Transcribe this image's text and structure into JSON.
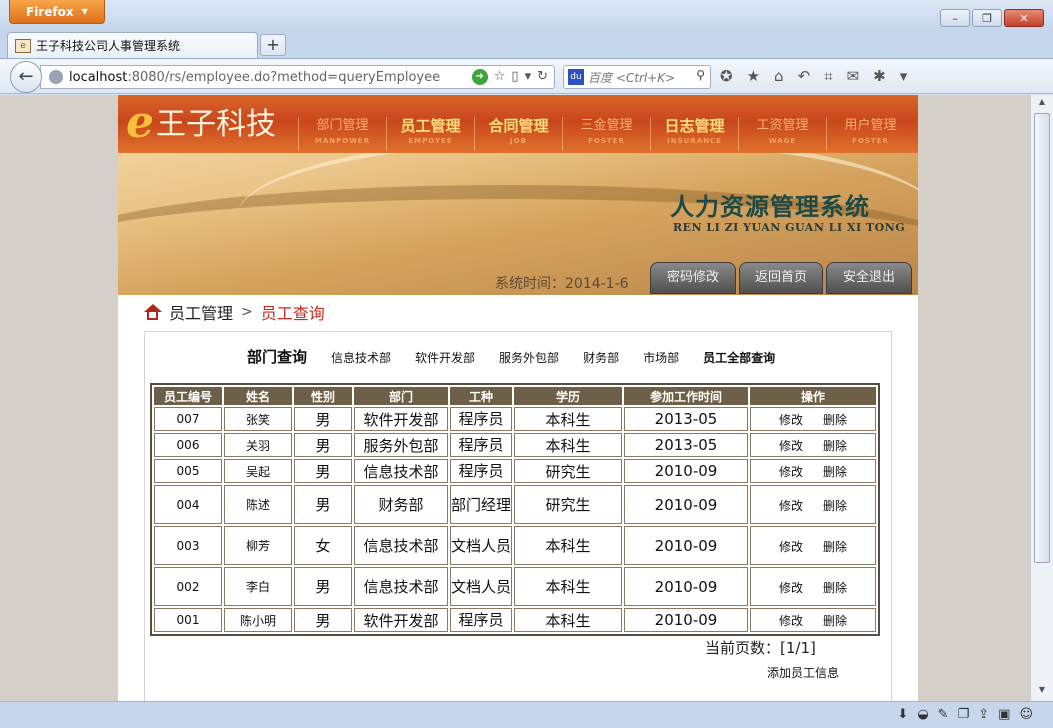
{
  "browser": {
    "app_button": "Firefox",
    "tab_title": "王子科技公司人事管理系统",
    "url_host": "localhost",
    "url_rest": ":8080/rs/employee.do?method=queryEmployee",
    "search_placeholder": "百度 <Ctrl+K>"
  },
  "header": {
    "logo_mark": "e",
    "logo_text": "王子科技",
    "nav": [
      {
        "zh": "部门管理",
        "en": "MANPOWER",
        "major": false
      },
      {
        "zh": "员工管理",
        "en": "EMPOYEE",
        "major": true
      },
      {
        "zh": "合同管理",
        "en": "JOB",
        "major": true
      },
      {
        "zh": "三金管理",
        "en": "FOSTER",
        "major": false
      },
      {
        "zh": "日志管理",
        "en": "INSURANCE",
        "major": true
      },
      {
        "zh": "工资管理",
        "en": "WAGE",
        "major": false
      },
      {
        "zh": "用户管理",
        "en": "FOSTER",
        "major": false
      }
    ],
    "system_title": "人力资源管理系统",
    "system_subtitle": "REN LI ZI YUAN GUAN LI XI TONG",
    "system_time": "系统时间：2014-1-6",
    "btn_password": "密码修改",
    "btn_home": "返回首页",
    "btn_logout": "安全退出"
  },
  "breadcrumb": {
    "parent": "员工管理",
    "separator": ">",
    "current": "员工查询"
  },
  "dept_filter": {
    "title": "部门查询",
    "links": [
      "信息技术部",
      "软件开发部",
      "服务外包部",
      "财务部",
      "市场部"
    ],
    "all_link": "员工全部查询"
  },
  "table": {
    "headers": [
      "员工编号",
      "姓名",
      "性别",
      "部门",
      "工种",
      "学历",
      "参加工作时间",
      "操作"
    ],
    "edit_label": "修改",
    "delete_label": "删除",
    "rows": [
      {
        "id": "007",
        "name": "张笑",
        "gender": "男",
        "dept": "软件开发部",
        "job": "程序员",
        "edu": "本科生",
        "start": "2013-05"
      },
      {
        "id": "006",
        "name": "关羽",
        "gender": "男",
        "dept": "服务外包部",
        "job": "程序员",
        "edu": "本科生",
        "start": "2013-05"
      },
      {
        "id": "005",
        "name": "吴起",
        "gender": "男",
        "dept": "信息技术部",
        "job": "程序员",
        "edu": "研究生",
        "start": "2010-09"
      },
      {
        "id": "004",
        "name": "陈述",
        "gender": "男",
        "dept": "财务部",
        "job": "部门经理",
        "edu": "研究生",
        "start": "2010-09"
      },
      {
        "id": "003",
        "name": "柳芳",
        "gender": "女",
        "dept": "信息技术部",
        "job": "文档人员",
        "edu": "本科生",
        "start": "2010-09"
      },
      {
        "id": "002",
        "name": "李白",
        "gender": "男",
        "dept": "信息技术部",
        "job": "文档人员",
        "edu": "本科生",
        "start": "2010-09"
      },
      {
        "id": "001",
        "name": "陈小明",
        "gender": "男",
        "dept": "软件开发部",
        "job": "程序员",
        "edu": "本科生",
        "start": "2010-09"
      }
    ]
  },
  "pagination": "当前页数：[1/1]",
  "add_link": "添加员工信息"
}
